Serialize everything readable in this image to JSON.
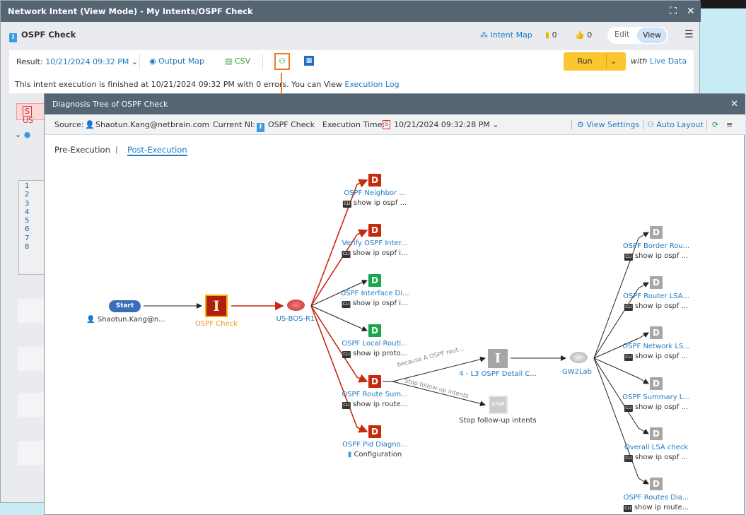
{
  "window": {
    "title": "Network Intent (View Mode) - My Intents/OSPF Check"
  },
  "header": {
    "name": "OSPF Check",
    "intent_map": "Intent Map",
    "notes_count": "0",
    "likes_count": "0",
    "edit": "Edit",
    "view": "View"
  },
  "toolbar": {
    "result_label": "Result:",
    "result_value": "10/21/2024 09:32 PM",
    "output_map": "Output Map",
    "csv": "CSV",
    "run": "Run",
    "with": "with",
    "live_data": "Live Data"
  },
  "message": {
    "text": "This intent execution is finished at 10/21/2024 09:32 PM with 0 errors. You can View",
    "link": "Execution Log"
  },
  "left_panel": {
    "line_numbers": [
      "1",
      "2",
      "3",
      "4",
      "5",
      "6",
      "7",
      "8"
    ],
    "badge": "S",
    "badge_text": "US"
  },
  "dialog": {
    "title": "Diagnosis Tree of OSPF Check",
    "source_label": "Source:",
    "source_value": "Shaotun.Kang@netbrain.com",
    "current_ni_label": "Current NI:",
    "current_ni_value": "OSPF Check",
    "exec_time_label": "Execution Time:",
    "exec_time_value": "10/21/2024 09:32:28 PM",
    "view_settings": "View Settings",
    "auto_layout": "Auto Layout",
    "tabs": [
      "Pre-Execution",
      "Post-Execution"
    ],
    "active_tab": "Post-Execution"
  },
  "tree": {
    "start": "Start",
    "start_user": "Shaotun.Kang@n...",
    "intent": "OSPF Check",
    "device": "US-BOS-R1",
    "branches": [
      {
        "name": "OSPF Neighbor ...",
        "sub": "show ip ospf ...",
        "status": "red",
        "edge": "red",
        "sub_icon": "cli"
      },
      {
        "name": "Verify OSPF Inter...",
        "sub": "show ip ospf i...",
        "status": "red",
        "edge": "red",
        "sub_icon": "cli"
      },
      {
        "name": "OSPF Interface Di...",
        "sub": "show ip ospf i...",
        "status": "green",
        "edge": "black",
        "sub_icon": "cli"
      },
      {
        "name": "OSPF Local Routi...",
        "sub": "show ip proto...",
        "status": "green",
        "edge": "black",
        "sub_icon": "cli"
      },
      {
        "name": "OSPF Route Sum...",
        "sub": "show ip route...",
        "status": "red",
        "edge": "red",
        "sub_icon": "cli"
      },
      {
        "name": "OSPF Pid Diagno...",
        "sub": "Configuration",
        "status": "red",
        "edge": "red",
        "sub_icon": "config"
      }
    ],
    "followup": {
      "edge1": "because A OSPF rout...",
      "node1": "4 - L3 OSPF Detail C...",
      "edge2": "Stop follow-up intents",
      "node2": "Stop follow-up intents",
      "stop": "STOP",
      "device2": "GW2Lab"
    },
    "right_branches": [
      {
        "name": "OSPF Border Rou...",
        "sub": "show ip ospf ..."
      },
      {
        "name": "OSPF Router LSA...",
        "sub": "show ip ospf ..."
      },
      {
        "name": "OSPF Network LS...",
        "sub": "show ip ospf ..."
      },
      {
        "name": "OSPF Summary L...",
        "sub": "show ip ospf ..."
      },
      {
        "name": "Overall LSA check",
        "sub": "show ip ospf ..."
      },
      {
        "name": "OSPF Routes Dia...",
        "sub": "show ip route..."
      }
    ],
    "node_letter": "D",
    "intent_letter": "I",
    "cli": "CLI"
  },
  "colors": {
    "red": "#c7290f",
    "green": "#17a84b",
    "gray": "#a6a6a6",
    "accent": "#1e7ac4",
    "highlight": "#f47a20",
    "run": "#fcc630"
  }
}
